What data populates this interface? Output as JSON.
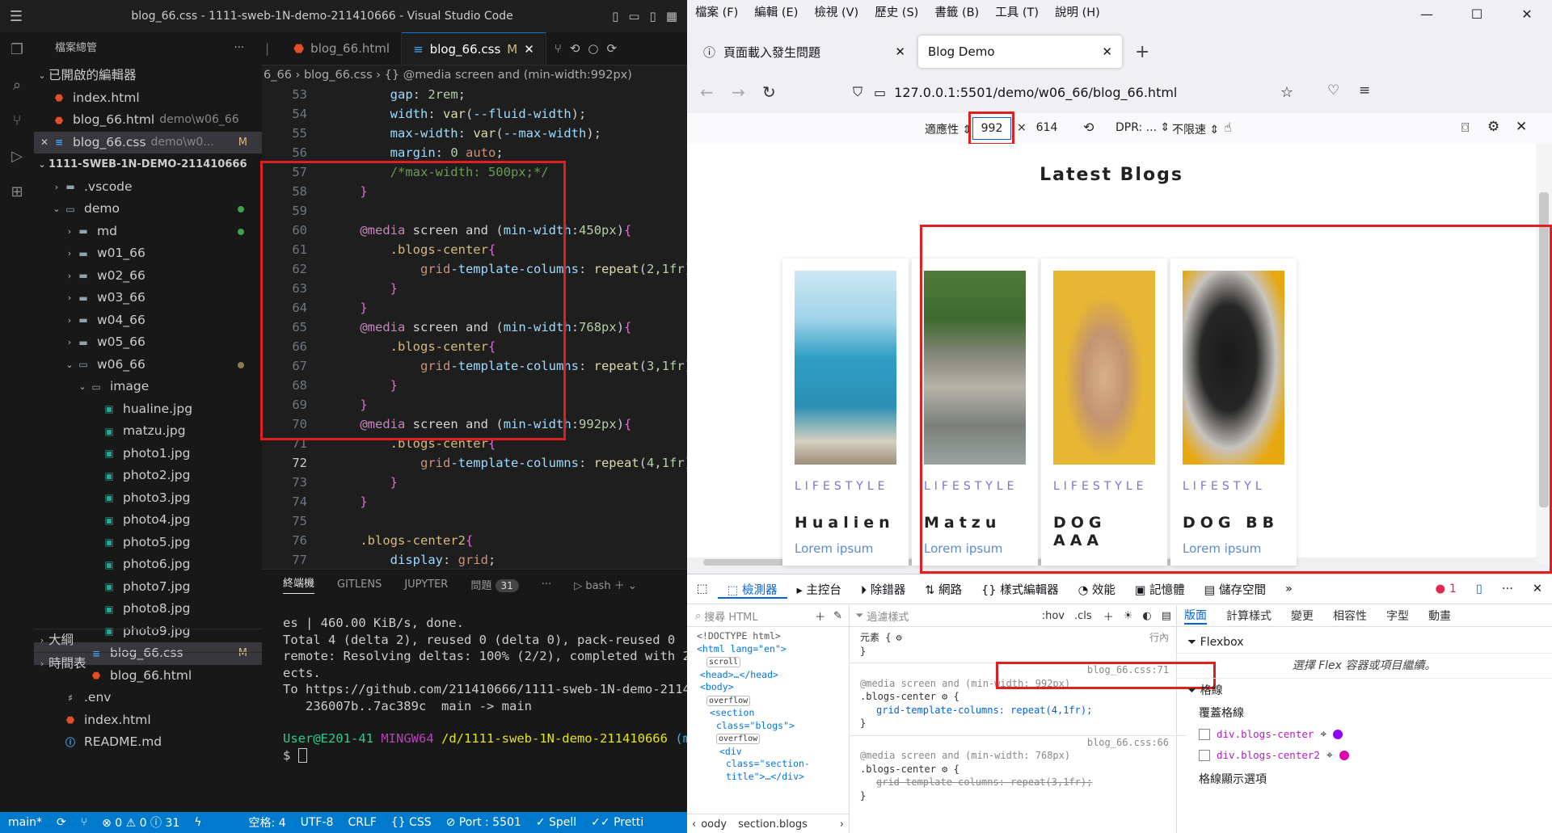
{
  "vscode": {
    "window_title": "blog_66.css - 1111-sweb-1N-demo-211410666 - Visual Studio Code",
    "explorer_title": "檔案總管",
    "explorer_more": "···",
    "open_editors_label": "已開啟的編輯器",
    "open_editors": [
      {
        "name": "index.html",
        "desc": "",
        "type": "html"
      },
      {
        "name": "blog_66.html",
        "desc": "demo\\w06_66",
        "type": "html"
      },
      {
        "name": "blog_66.css",
        "desc": "demo\\w0...",
        "type": "css",
        "badge": "M"
      }
    ],
    "root_folder": "1111-SWEB-1N-DEMO-211410666",
    "tree": [
      {
        "name": ".vscode",
        "level": 1,
        "kind": "folder",
        "chev": "›"
      },
      {
        "name": "demo",
        "level": 1,
        "kind": "folder-open",
        "chev": "⌄",
        "dot": "#3fa34d"
      },
      {
        "name": "md",
        "level": 2,
        "kind": "folder",
        "chev": "›",
        "dot": "#3fa34d"
      },
      {
        "name": "w01_66",
        "level": 2,
        "kind": "folder",
        "chev": "›"
      },
      {
        "name": "w02_66",
        "level": 2,
        "kind": "folder",
        "chev": "›"
      },
      {
        "name": "w03_66",
        "level": 2,
        "kind": "folder",
        "chev": "›"
      },
      {
        "name": "w04_66",
        "level": 2,
        "kind": "folder",
        "chev": "›"
      },
      {
        "name": "w05_66",
        "level": 2,
        "kind": "folder",
        "chev": "›"
      },
      {
        "name": "w06_66",
        "level": 2,
        "kind": "folder-open",
        "chev": "⌄",
        "dot": "#8a7b52"
      },
      {
        "name": "image",
        "level": 3,
        "kind": "folder-open",
        "chev": "⌄"
      },
      {
        "name": "hualine.jpg",
        "level": 4,
        "kind": "img"
      },
      {
        "name": "matzu.jpg",
        "level": 4,
        "kind": "img"
      },
      {
        "name": "photo1.jpg",
        "level": 4,
        "kind": "img"
      },
      {
        "name": "photo2.jpg",
        "level": 4,
        "kind": "img"
      },
      {
        "name": "photo3.jpg",
        "level": 4,
        "kind": "img"
      },
      {
        "name": "photo4.jpg",
        "level": 4,
        "kind": "img"
      },
      {
        "name": "photo5.jpg",
        "level": 4,
        "kind": "img"
      },
      {
        "name": "photo6.jpg",
        "level": 4,
        "kind": "img"
      },
      {
        "name": "photo7.jpg",
        "level": 4,
        "kind": "img"
      },
      {
        "name": "photo8.jpg",
        "level": 4,
        "kind": "img"
      },
      {
        "name": "photo9.jpg",
        "level": 4,
        "kind": "img"
      },
      {
        "name": "blog_66.css",
        "level": 3,
        "kind": "css",
        "badge": "M",
        "selected": true
      },
      {
        "name": "blog_66.html",
        "level": 3,
        "kind": "html"
      },
      {
        "name": ".env",
        "level": 1,
        "kind": "env"
      },
      {
        "name": "index.html",
        "level": 1,
        "kind": "html"
      },
      {
        "name": "README.md",
        "level": 1,
        "kind": "info"
      }
    ],
    "outline_label": "大綱",
    "timeline_label": "時間表",
    "tabs": [
      {
        "name": "blog_66.html",
        "type": "html",
        "active": false
      },
      {
        "name": "blog_66.css",
        "type": "css",
        "active": true,
        "badge": "M",
        "close": "✕"
      }
    ],
    "breadcrumb": "6_66 › blog_66.css › {} @media screen and (min-width:992px)",
    "current_line": "72",
    "code": [
      {
        "n": "53",
        "t": "        gap: 2rem;"
      },
      {
        "n": "54",
        "t": "        width: var(--fluid-width);"
      },
      {
        "n": "55",
        "t": "        max-width: var(--max-width);"
      },
      {
        "n": "56",
        "t": "        margin: 0 auto;"
      },
      {
        "n": "57",
        "t": "        /*max-width: 500px;*/"
      },
      {
        "n": "58",
        "t": "    }"
      },
      {
        "n": "59",
        "t": ""
      },
      {
        "n": "60",
        "t": "    @media screen and (min-width:450px){"
      },
      {
        "n": "61",
        "t": "        .blogs-center{"
      },
      {
        "n": "62",
        "t": "            grid-template-columns: repeat(2,1fr);"
      },
      {
        "n": "63",
        "t": "        }"
      },
      {
        "n": "64",
        "t": "    }"
      },
      {
        "n": "65",
        "t": "    @media screen and (min-width:768px){"
      },
      {
        "n": "66",
        "t": "        .blogs-center{"
      },
      {
        "n": "67",
        "t": "            grid-template-columns: repeat(3,1fr);"
      },
      {
        "n": "68",
        "t": "        }"
      },
      {
        "n": "69",
        "t": "    }"
      },
      {
        "n": "70",
        "t": "    @media screen and (min-width:992px){"
      },
      {
        "n": "71",
        "t": "        .blogs-center{"
      },
      {
        "n": "72",
        "t": "            grid-template-columns: repeat(4,1fr);"
      },
      {
        "n": "73",
        "t": "        }"
      },
      {
        "n": "74",
        "t": "    }"
      },
      {
        "n": "75",
        "t": ""
      },
      {
        "n": "76",
        "t": "    .blogs-center2{"
      },
      {
        "n": "77",
        "t": "        display: grid;"
      }
    ],
    "panel_tabs": [
      "終端機",
      "GITLENS",
      "JUPYTER",
      "問題"
    ],
    "problem_count": "31",
    "panel_more": "···",
    "shell_label": "bash",
    "terminal_lines": [
      "es | 460.00 KiB/s, done.",
      "Total 4 (delta 2), reused 0 (delta 0), pack-reused 0",
      "remote: Resolving deltas: 100% (2/2), completed with 2",
      "ects.",
      "To https://github.com/211410666/1111-sweb-1N-demo-21141",
      "   236007b..7ac389c  main -> main"
    ],
    "prompt_user": "User@E201-41",
    "prompt_host": "MINGW64",
    "prompt_path": "/d/1111-sweb-1N-demo-211410666",
    "prompt_branch": "(ma",
    "prompt_symbol": "$",
    "status": {
      "branch": "main*",
      "errors": "⊗ 0 ⚠ 0 ⓘ 31",
      "spaces": "空格: 4",
      "encoding": "UTF-8",
      "eol": "CRLF",
      "lang": "{} CSS",
      "port": "⊘ Port : 5501",
      "spell": "✓ Spell",
      "prettier": "✓✓ Pretti"
    }
  },
  "firefox": {
    "menu": [
      "檔案 (F)",
      "編輯 (E)",
      "檢視 (V)",
      "歷史 (S)",
      "書籤 (B)",
      "工具 (T)",
      "說明 (H)"
    ],
    "tabs": [
      {
        "title": "頁面載入發生問題",
        "active": false
      },
      {
        "title": "Blog Demo",
        "active": true
      }
    ],
    "new_tab": "+",
    "url": "127.0.0.1:5501/demo/w06_66/blog_66.html",
    "url_host": "127.0.0.1",
    "rdm": {
      "device_label": "適應性",
      "width": "992",
      "times": "×",
      "height": "614",
      "dpr": "DPR: ...",
      "throttle": "不限速"
    },
    "page": {
      "heading": "Latest Blogs",
      "cards": [
        {
          "tag": "LIFESTYLE",
          "title": "Hualien",
          "text": "Lorem ipsum"
        },
        {
          "tag": "LIFESTYLE",
          "title": "Matzu",
          "text": "Lorem ipsum"
        },
        {
          "tag": "LIFESTYLE",
          "title": "DOG AAA",
          "text": ""
        },
        {
          "tag": "LIFESTYL",
          "title": "DOG BB",
          "text": "Lorem ipsum"
        }
      ]
    },
    "devtools": {
      "tools": [
        "檢測器",
        "主控台",
        "除錯器",
        "網路",
        "樣式編輯器",
        "效能",
        "記憶體",
        "儲存空間"
      ],
      "error_count": "1",
      "search_html": "搜尋 HTML",
      "filter_styles": "過濾樣式",
      "hov": ":hov",
      "cls": ".cls",
      "layout_tabs": [
        "版面",
        "計算樣式",
        "變更",
        "相容性",
        "字型",
        "動畫"
      ],
      "html_tree": [
        "<!DOCTYPE html>",
        "<html lang=\"en\">",
        "scroll",
        "<head>…</head>",
        "<body>",
        "overflow",
        "<section",
        "class=\"blogs\">",
        "overflow",
        "<div",
        "class=\"section-",
        "title\">…</div>"
      ],
      "crumbs": [
        "oody",
        "section.blogs"
      ],
      "rules": {
        "element": "元素 {",
        "element_close": "}",
        "inline": "行內",
        "src1": "blog_66.css:71",
        "media1": "@media screen and (min-width: 992px)",
        "sel1": ".blogs-center",
        "decl1": "grid-template-columns: repeat(4,1fr);",
        "src2": "blog_66.css:66",
        "media2": "@media screen and (min-width: 768px)",
        "sel2": ".blogs-center",
        "decl2": "grid-template-columns: repeat(3,1fr);"
      },
      "flexbox_title": "Flexbox",
      "flexbox_hint": "選擇 Flex 容器或項目繼續。",
      "grid_title": "格線",
      "overlay_title": "覆蓋格線",
      "grid_items": [
        {
          "name": "div.blogs-center",
          "color": "#9400ff"
        },
        {
          "name": "div.blogs-center2",
          "color": "#e000b0"
        }
      ],
      "grid_display": "格線顯示選項"
    }
  }
}
